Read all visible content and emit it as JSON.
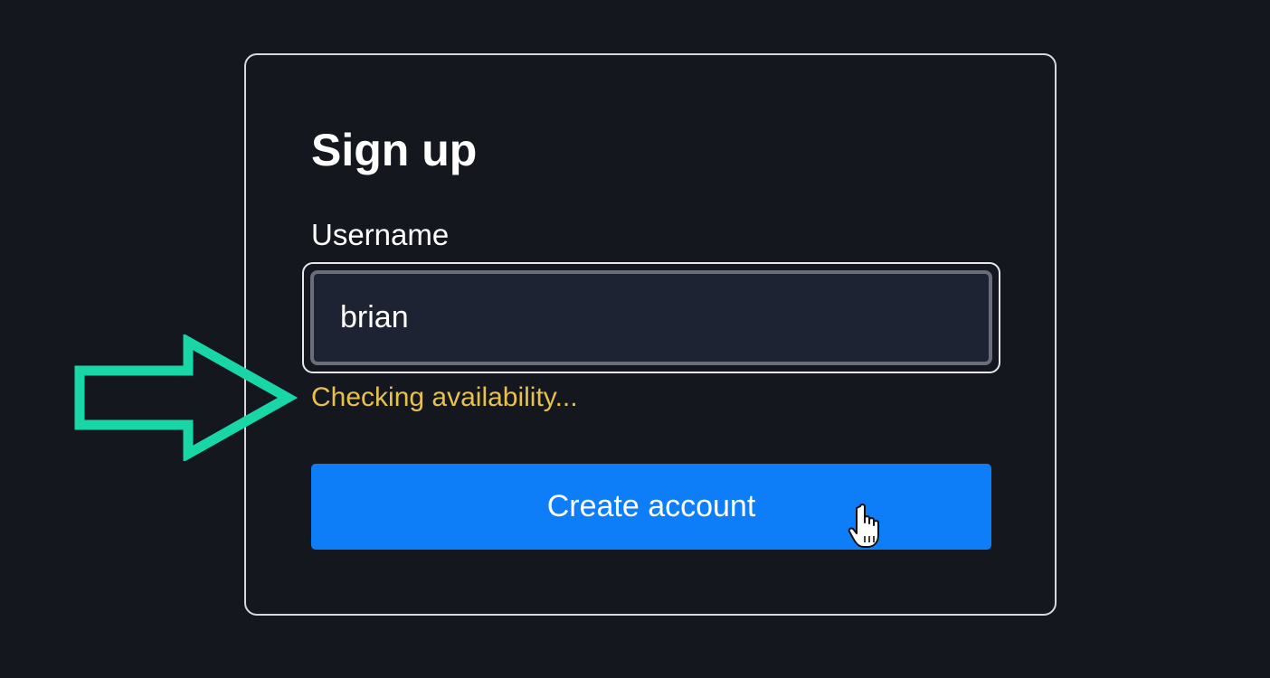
{
  "form": {
    "title": "Sign up",
    "username_label": "Username",
    "username_value": "brian",
    "status_text": "Checking availability...",
    "submit_label": "Create account"
  },
  "annotations": {
    "arrow_icon": "right-arrow-outline-icon",
    "arrow_color": "#18d6a6",
    "cursor_icon": "hand-pointer-cursor-icon"
  },
  "colors": {
    "background": "#15171e",
    "accent": "#0d7ef8",
    "status": "#e7c04e",
    "spellcheck_underline": "#d93a3a"
  }
}
